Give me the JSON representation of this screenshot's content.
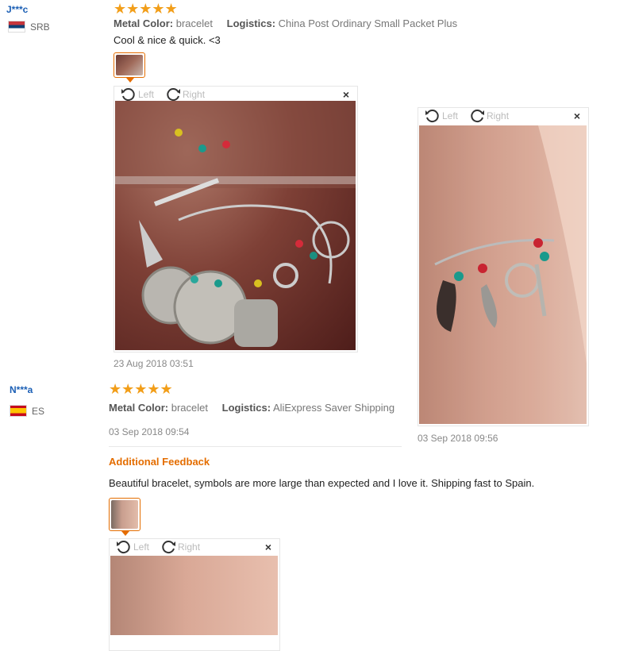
{
  "reviews": [
    {
      "user": "J***c",
      "country": "SRB",
      "stars": "★★★★★",
      "metal_label": "Metal Color:",
      "metal_value": "bracelet",
      "logistics_label": "Logistics:",
      "logistics_value": "China Post Ordinary Small Packet Plus",
      "text": "Cool & nice & quick. <3",
      "viewer": {
        "left": "Left",
        "right": "Right",
        "close": "×"
      },
      "date": "23 Aug 2018 03:51",
      "side_viewer": {
        "left": "Left",
        "right": "Right",
        "close": "×"
      },
      "side_date": "03 Sep 2018 09:56"
    },
    {
      "user": "N***a",
      "country": "ES",
      "stars": "★★★★★",
      "metal_label": "Metal Color:",
      "metal_value": "bracelet",
      "logistics_label": "Logistics:",
      "logistics_value": "AliExpress Saver Shipping",
      "date": "03 Sep 2018 09:54",
      "additional_title": "Additional Feedback",
      "additional_text": "Beautiful bracelet, symbols are more large than expected and I love it. Shipping fast to Spain.",
      "viewer": {
        "left": "Left",
        "right": "Right",
        "close": "×"
      }
    }
  ],
  "colors": {
    "accent": "#e46d00",
    "user": "#1b5fb5",
    "star": "#f29e19"
  },
  "icons": [
    "rotate-left-icon",
    "rotate-right-icon",
    "close-icon",
    "star-icon",
    "flag-icon"
  ]
}
